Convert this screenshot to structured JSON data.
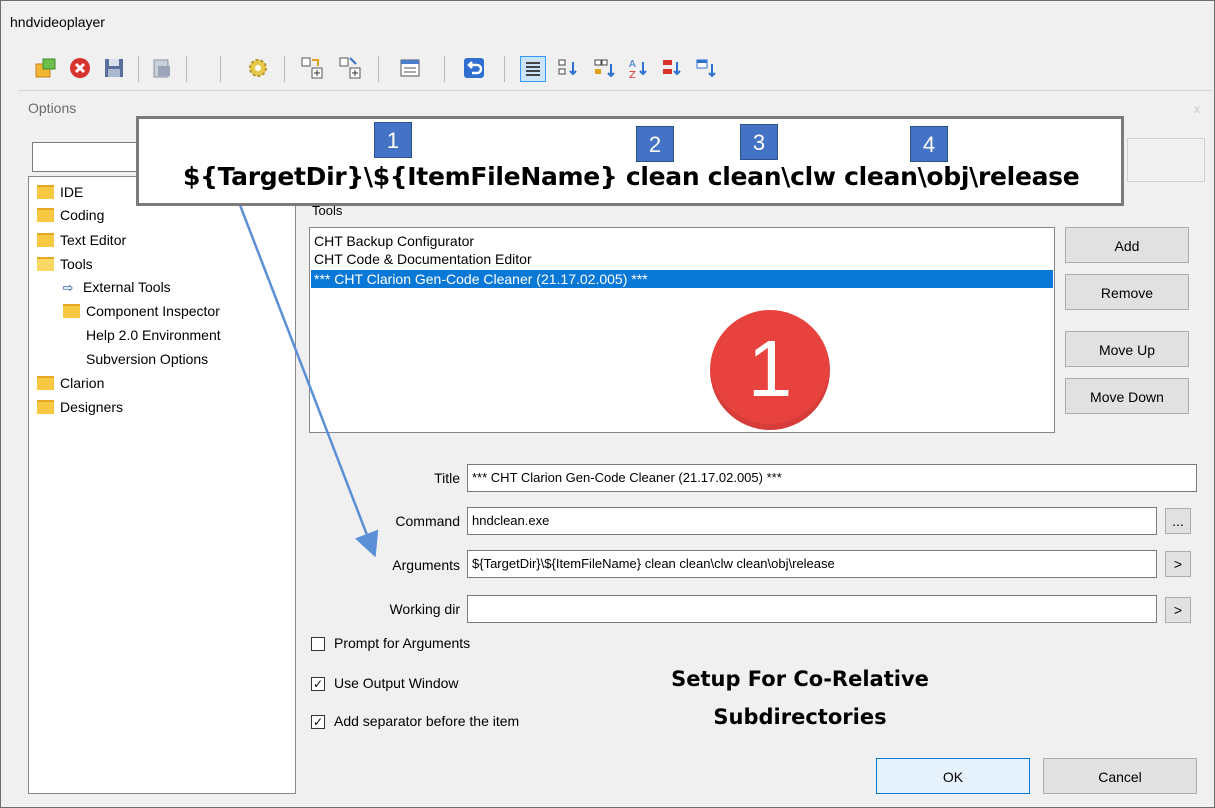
{
  "app": {
    "title": "hndvideoplayer"
  },
  "dialog": {
    "title": "Options",
    "close_glyph": "x"
  },
  "tree": {
    "items": [
      {
        "label": "IDE",
        "icon": "folder-icon"
      },
      {
        "label": "Coding",
        "icon": "folder-icon"
      },
      {
        "label": "Text Editor",
        "icon": "folder-icon"
      },
      {
        "label": "Tools",
        "icon": "folder-open-icon"
      },
      {
        "label": "External Tools",
        "icon": "arrow-right-icon"
      },
      {
        "label": "Component Inspector",
        "icon": "folder-icon"
      },
      {
        "label": "Help 2.0 Environment",
        "icon": ""
      },
      {
        "label": "Subversion Options",
        "icon": ""
      },
      {
        "label": "Clarion",
        "icon": "folder-icon"
      },
      {
        "label": "Designers",
        "icon": "folder-icon"
      }
    ]
  },
  "tools": {
    "label": "Tools",
    "items": [
      "CHT Backup Configurator",
      "CHT Code & Documentation Editor",
      "*** CHT Clarion Gen-Code Cleaner (21.17.02.005) ***"
    ],
    "selected_index": 2
  },
  "buttons": {
    "add": "Add",
    "remove": "Remove",
    "move_up": "Move Up",
    "move_down": "Move Down",
    "ok": "OK",
    "cancel": "Cancel",
    "browse": "...",
    "arg_menu": ">",
    "dir_menu": ">"
  },
  "fields": {
    "title_label": "Title",
    "title_value": "*** CHT Clarion Gen-Code Cleaner (21.17.02.005) ***",
    "command_label": "Command",
    "command_value": "hndclean.exe",
    "arguments_label": "Arguments",
    "arguments_value": "${TargetDir}\\${ItemFileName} clean clean\\clw clean\\obj\\release",
    "working_dir_label": "Working dir",
    "working_dir_value": ""
  },
  "checkboxes": {
    "prompt_label": "Prompt for Arguments",
    "prompt_checked": false,
    "output_label": "Use Output Window",
    "output_checked": true,
    "separator_label": "Add separator before the item",
    "separator_checked": true
  },
  "annotation": {
    "callout_text": "${TargetDir}\\${ItemFileName} clean clean\\clw clean\\obj\\release",
    "badges": [
      "1",
      "2",
      "3",
      "4"
    ],
    "circle_number": "1",
    "note_line1": "Setup For Co-Relative",
    "note_line2": "Subdirectories",
    "arrow_color": "#5b8fd6",
    "badge_color": "#4472c4",
    "circle_color": "#e8423f"
  },
  "colors": {
    "selection": "#0a78d7"
  }
}
